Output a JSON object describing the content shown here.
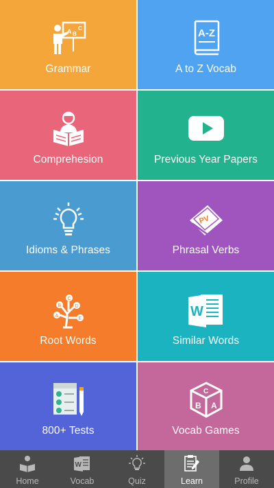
{
  "tiles": [
    {
      "label": "Grammar",
      "icon": "teacher-board-icon",
      "color": "#F5A63A"
    },
    {
      "label": "A to Z Vocab",
      "icon": "az-book-icon",
      "color": "#4FA3F0"
    },
    {
      "label": "Comprehesion",
      "icon": "reading-person-icon",
      "color": "#E9667A"
    },
    {
      "label": "Previous Year Papers",
      "icon": "play-video-icon",
      "color": "#22B38E"
    },
    {
      "label": "Idioms & Phrases",
      "icon": "lightbulb-icon",
      "color": "#4A9CD0"
    },
    {
      "label": "Phrasal Verbs",
      "icon": "pv-book-icon",
      "color": "#A055BE"
    },
    {
      "label": "Root Words",
      "icon": "letter-tree-icon",
      "color": "#F47C2B"
    },
    {
      "label": "Similar Words",
      "icon": "word-document-icon",
      "color": "#1BB3C0"
    },
    {
      "label": "800+ Tests",
      "icon": "checklist-icon",
      "color": "#5264D8"
    },
    {
      "label": "Vocab Games",
      "icon": "abc-cube-icon",
      "color": "#C4679B"
    }
  ],
  "nav": [
    {
      "label": "Home",
      "icon": "home-reader-icon",
      "active": false
    },
    {
      "label": "Vocab",
      "icon": "word-icon",
      "active": false
    },
    {
      "label": "Quiz",
      "icon": "bulb-icon",
      "active": false
    },
    {
      "label": "Learn",
      "icon": "clipboard-pen-icon",
      "active": true
    },
    {
      "label": "Profile",
      "icon": "person-icon",
      "active": false
    }
  ],
  "colors": {
    "nav_bg": "#4A4A4A",
    "nav_active_bg": "#6D6D6D",
    "nav_inactive_text": "#B9B9B9"
  }
}
